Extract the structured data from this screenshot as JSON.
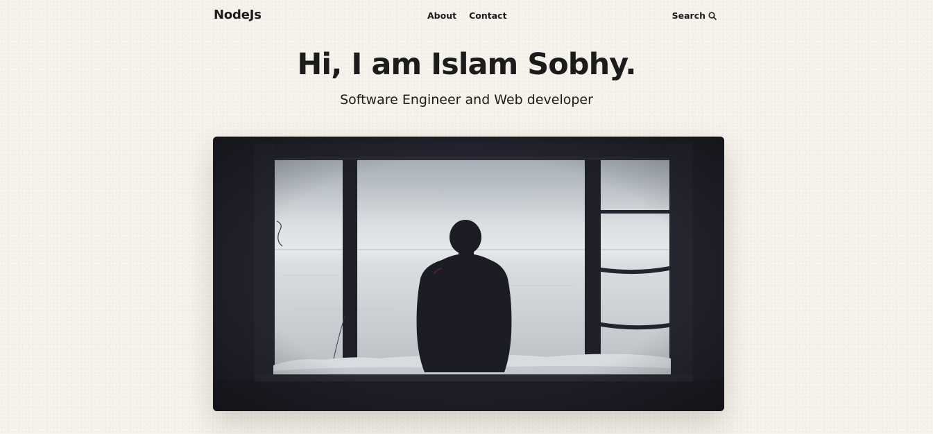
{
  "header": {
    "logo": "NodeJs",
    "nav": [
      {
        "label": "About"
      },
      {
        "label": "Contact"
      }
    ],
    "search": {
      "label": "Search",
      "icon": "search-icon"
    }
  },
  "hero": {
    "title": "Hi, I am Islam Sobhy.",
    "subtitle": "Software Engineer and Web developer",
    "image": {
      "icon": "hero-image"
    }
  },
  "colors": {
    "background": "#f6f2ec",
    "text": "#1c1c1c",
    "frame": "#20202a"
  }
}
